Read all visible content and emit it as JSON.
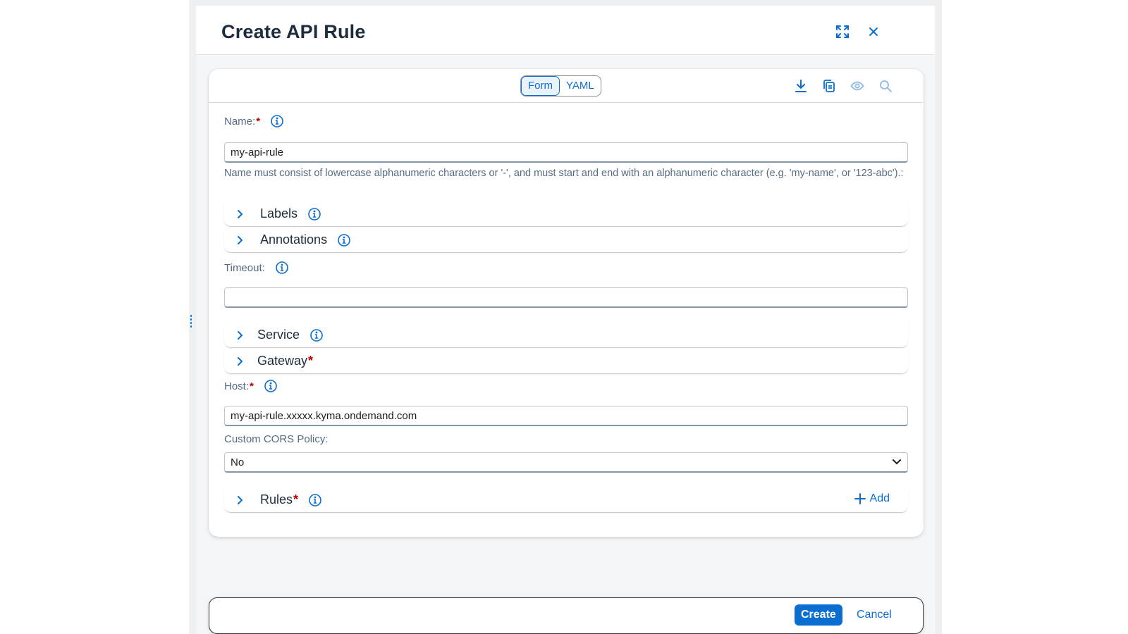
{
  "dialog": {
    "title": "Create API Rule",
    "maximize_icon": "maximize-icon",
    "close_icon": "close-icon"
  },
  "toolbar": {
    "tabs": [
      {
        "label": "Form",
        "active": true
      },
      {
        "label": "YAML",
        "active": false
      }
    ],
    "icons": [
      "download-icon",
      "copy-icon",
      "eye-icon",
      "search-icon"
    ]
  },
  "form": {
    "name": {
      "label": "Name:",
      "required": "*",
      "value": "my-api-rule",
      "hint": "Name must consist of lowercase alphanumeric characters or '-', and must start and end with an alphanumeric character (e.g. 'my-name', or '123-abc').:"
    },
    "labels_panel": {
      "title": "Labels"
    },
    "annotations_panel": {
      "title": "Annotations"
    },
    "timeout": {
      "label": "Timeout:",
      "value": ""
    },
    "service_panel": {
      "title": "Service"
    },
    "gateway_panel": {
      "title": "Gateway",
      "required": "*"
    },
    "host": {
      "label": "Host:",
      "required": "*",
      "value": "my-api-rule.xxxxx.kyma.ondemand.com"
    },
    "cors": {
      "label": "Custom CORS Policy:",
      "selected": "No"
    },
    "rules_panel": {
      "title": "Rules",
      "required": "*",
      "add_label": "Add"
    }
  },
  "footer": {
    "create_label": "Create",
    "cancel_label": "Cancel"
  },
  "colors": {
    "accent": "#0a6ed1",
    "required": "#bb0000",
    "title": "#1d2d3e"
  }
}
